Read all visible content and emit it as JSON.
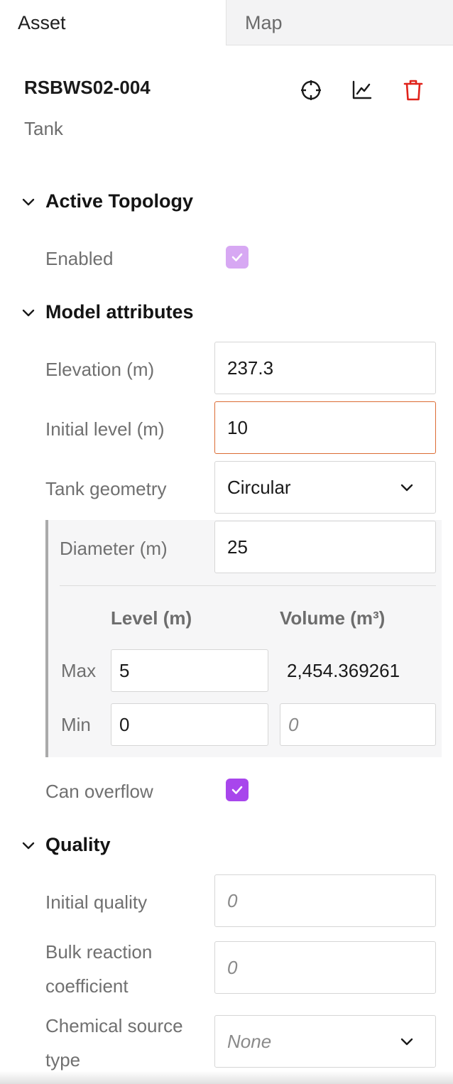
{
  "tabs": {
    "asset": "Asset",
    "map": "Map"
  },
  "asset": {
    "id": "RSBWS02-004",
    "type": "Tank"
  },
  "toolbar": {
    "locate_icon": "crosshair-icon",
    "chart_icon": "line-chart-icon",
    "delete_icon": "trash-icon",
    "delete_color": "#e0231b"
  },
  "sections": {
    "active_topology": {
      "title": "Active Topology",
      "enabled_label": "Enabled",
      "enabled_checked": true
    },
    "model_attributes": {
      "title": "Model attributes",
      "elevation_label": "Elevation (m)",
      "elevation_value": "237.3",
      "initial_level_label": "Initial level (m)",
      "initial_level_value": "10",
      "tank_geometry_label": "Tank geometry",
      "tank_geometry_value": "Circular",
      "diameter_label": "Diameter (m)",
      "diameter_value": "25",
      "level_header": "Level (m)",
      "volume_header": "Volume (m³)",
      "max_label": "Max",
      "max_level": "5",
      "max_volume": "2,454.369261",
      "min_label": "Min",
      "min_level": "0",
      "min_volume_placeholder": "0",
      "can_overflow_label": "Can overflow",
      "can_overflow_checked": true
    },
    "quality": {
      "title": "Quality",
      "initial_quality_label": "Initial quality",
      "initial_quality_placeholder": "0",
      "bulk_reaction_label_1": "Bulk reaction",
      "bulk_reaction_label_2": "coefficient",
      "bulk_reaction_placeholder": "0",
      "chemical_source_label_1": "Chemical source",
      "chemical_source_label_2": "type",
      "chemical_source_value": "None"
    }
  },
  "colors": {
    "accent": "#a846ec",
    "accent_disabled": "#d7a8f3",
    "focus": "#dc6c34"
  }
}
